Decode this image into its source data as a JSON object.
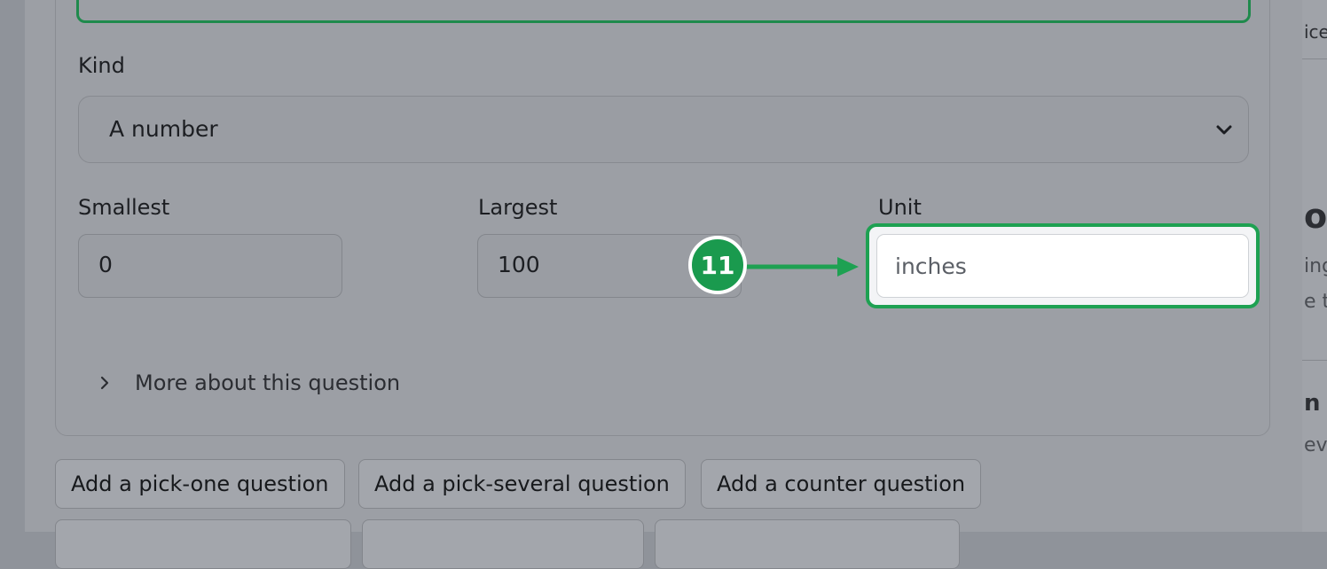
{
  "form": {
    "kind_label": "Kind",
    "kind_value": "A number",
    "smallest_label": "Smallest",
    "smallest_value": "0",
    "largest_label": "Largest",
    "largest_value": "100",
    "unit_label": "Unit",
    "unit_value": "inches",
    "more_label": "More about this question"
  },
  "annotation": {
    "step": "11",
    "color": "#1a9a4e"
  },
  "buttons": [
    "Add a pick-one question",
    "Add a pick-several question",
    "Add a counter question"
  ],
  "background_fragments": [
    "ice",
    "o",
    "ing",
    "e th",
    "n s",
    "eve"
  ]
}
